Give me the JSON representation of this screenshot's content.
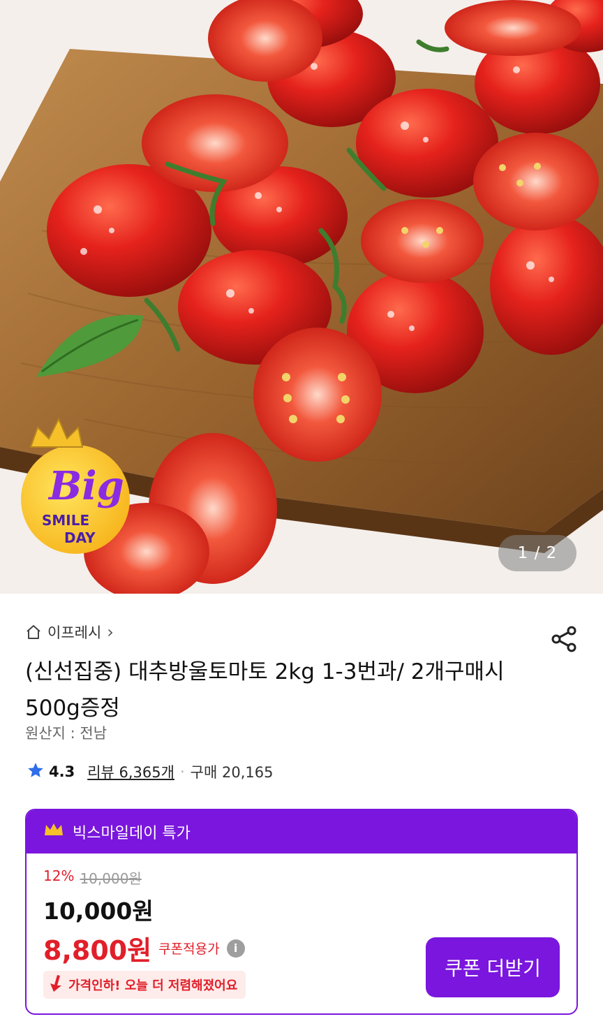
{
  "image": {
    "counter": "1 / 2",
    "badge": {
      "big": "Big",
      "line1": "SMILE",
      "line2": "DAY"
    }
  },
  "product": {
    "store_name": "이프레시",
    "store_chevron": "›",
    "title": "(신선집중) 대추방울토마토 2kg 1-3번과/ 2개구매시 500g증정",
    "origin": "원산지 : 전남",
    "rating": "4.3",
    "reviews": "리뷰 6,365개",
    "separator": "·",
    "purchases": "구매 20,165"
  },
  "deal": {
    "header_label": "빅스마일데이 특가",
    "discount_rate": "12%",
    "original_price": "10,000원",
    "sale_price": "10,000원",
    "coupon_price": "8,800원",
    "coupon_price_label": "쿠폰적용가",
    "info_icon_glyph": "i",
    "price_drop_text": "가격인하! 오늘 더 저렴해졌어요",
    "coupon_button": "쿠폰 더받기"
  },
  "icons": [
    "home-icon",
    "chevron-right-icon",
    "share-icon",
    "star-icon",
    "crown-icon",
    "info-icon",
    "down-arrow-icon"
  ],
  "colors": {
    "accent_purple": "#7a16dd",
    "price_red": "#e11f2a",
    "star_blue": "#2f6ee9",
    "crown_gold": "#f5c02a"
  }
}
